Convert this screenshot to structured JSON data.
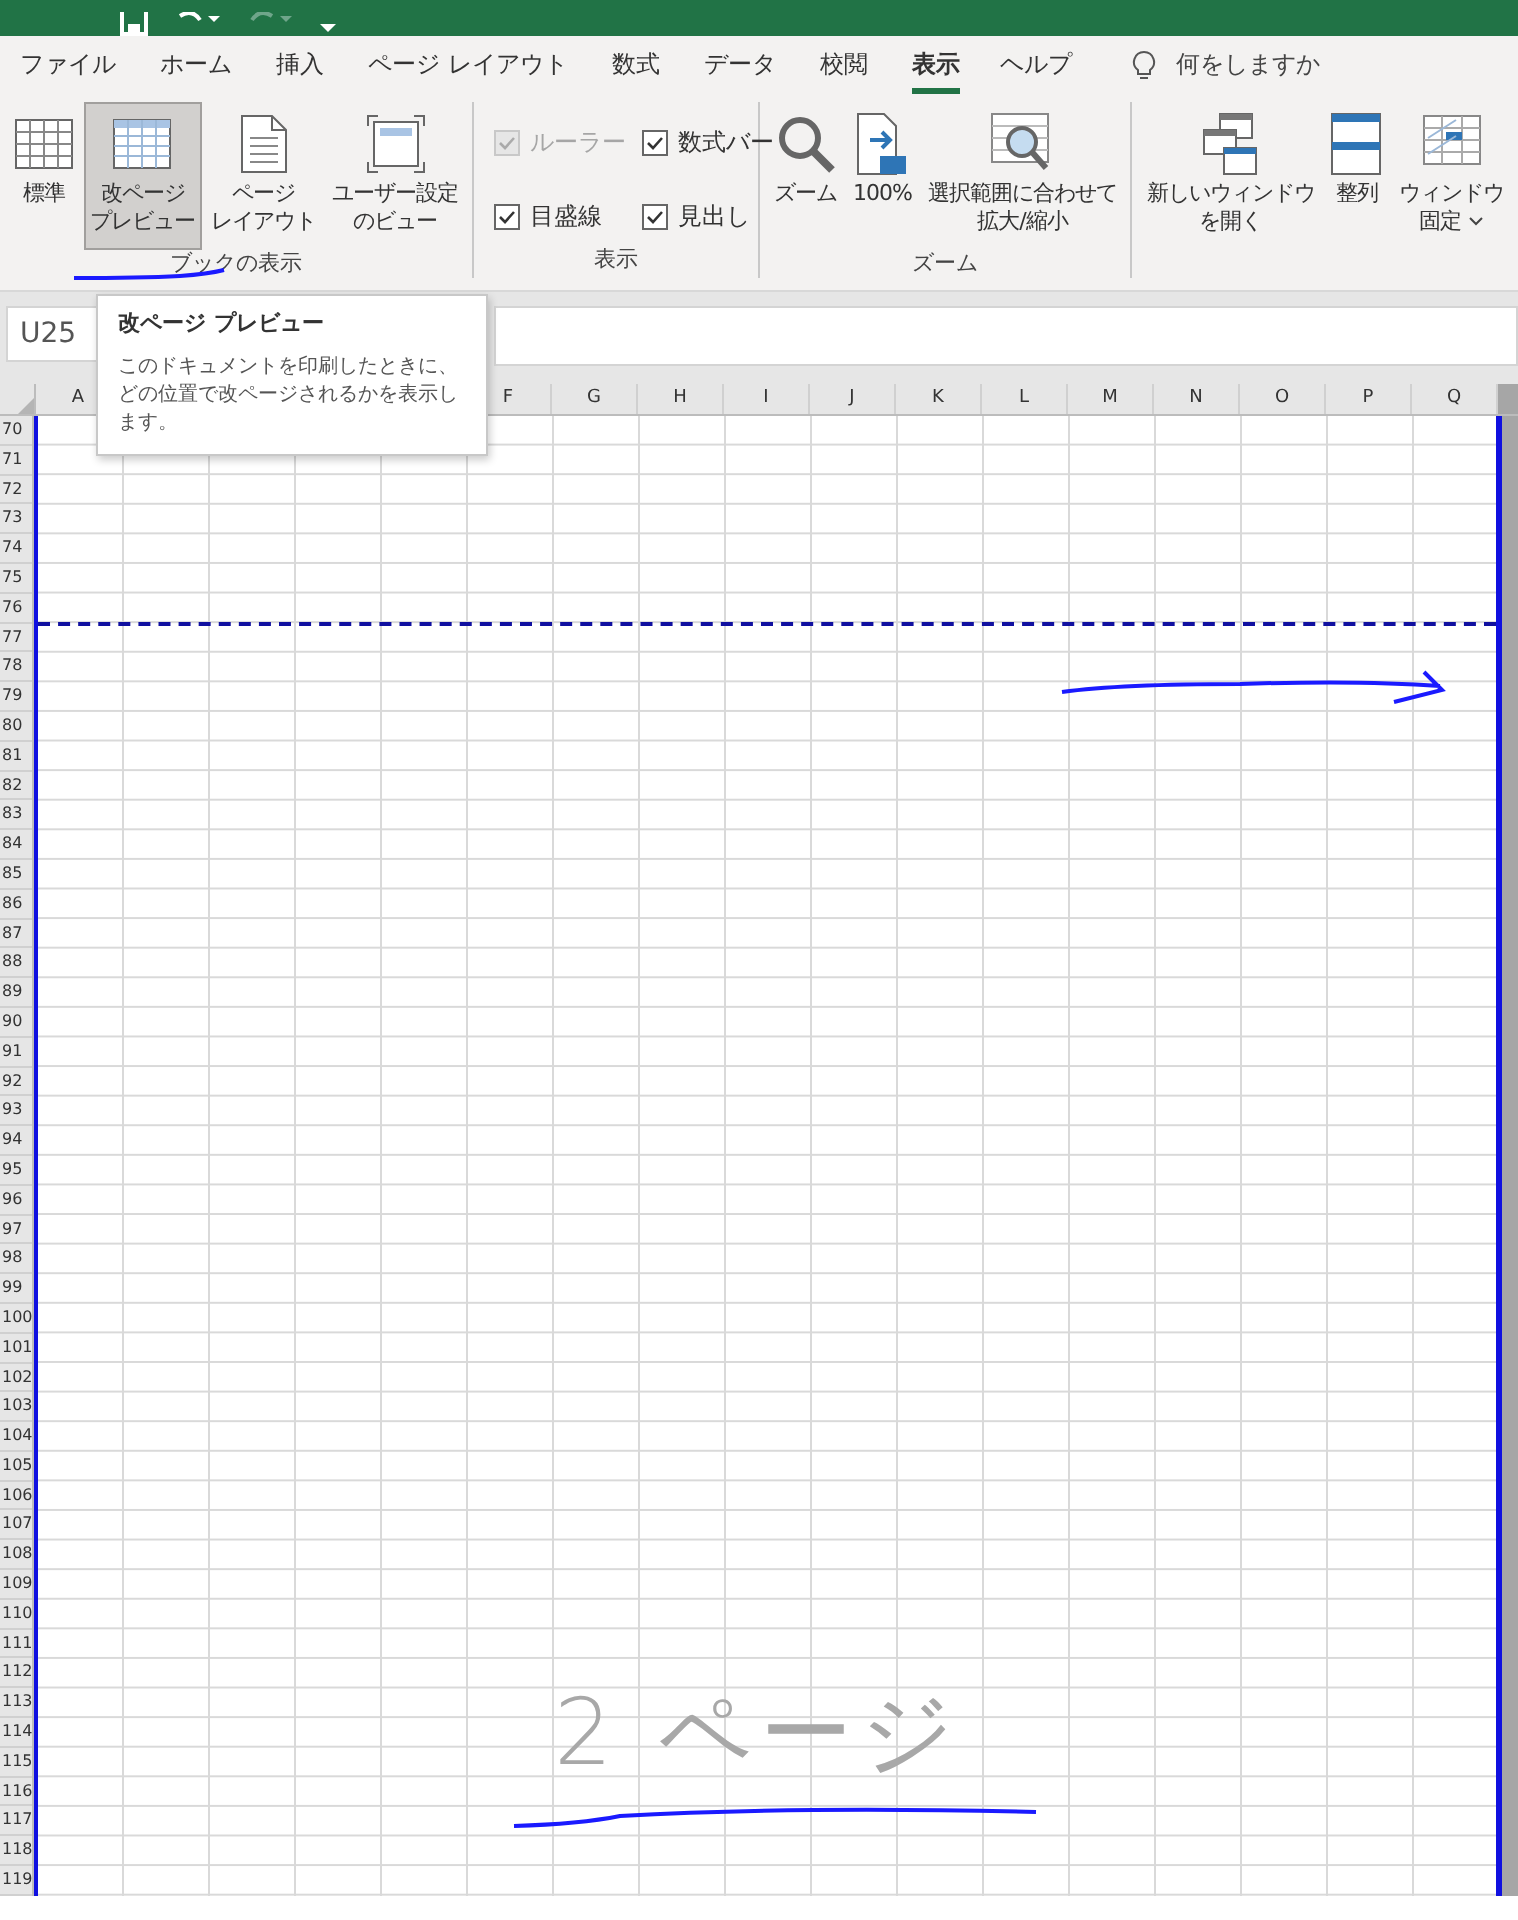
{
  "quick_access": [
    {
      "kind": "save"
    },
    {
      "kind": "undo"
    },
    {
      "kind": "redo",
      "disabled": true
    },
    {
      "kind": "customize"
    }
  ],
  "tabs": [
    {
      "label": "ファイル",
      "selected": false
    },
    {
      "label": "ホーム",
      "selected": false
    },
    {
      "label": "挿入",
      "selected": false
    },
    {
      "label": "ページ レイアウト",
      "selected": false
    },
    {
      "label": "数式",
      "selected": false
    },
    {
      "label": "データ",
      "selected": false
    },
    {
      "label": "校閲",
      "selected": false
    },
    {
      "label": "表示",
      "selected": true
    },
    {
      "label": "ヘルプ",
      "selected": false
    }
  ],
  "tell_me": {
    "placeholder": "何をしますか"
  },
  "ribbon_groups": [
    {
      "label": "ブックの表示",
      "kind": "buttons",
      "items": [
        {
          "lines": [
            "標準"
          ],
          "selected": false
        },
        {
          "lines": [
            "改ページ",
            "プレビュー"
          ],
          "selected": true
        },
        {
          "lines": [
            "ページ",
            "レイアウト"
          ],
          "selected": false
        },
        {
          "lines": [
            "ユーザー設定",
            "のビュー"
          ],
          "selected": false
        }
      ]
    },
    {
      "label": "表示",
      "kind": "checks",
      "items": [
        {
          "label": "ルーラー",
          "checked": true,
          "disabled": true
        },
        {
          "label": "数式バー",
          "checked": true,
          "disabled": false
        },
        {
          "label": "目盛線",
          "checked": true,
          "disabled": false
        },
        {
          "label": "見出し",
          "checked": true,
          "disabled": false
        }
      ]
    },
    {
      "label": "ズーム",
      "kind": "buttons",
      "items": [
        {
          "lines": [
            "ズーム"
          ],
          "selected": false
        },
        {
          "lines": [
            "100%"
          ],
          "selected": false
        },
        {
          "lines": [
            "選択範囲に合わせて",
            "拡大/縮小"
          ],
          "selected": false
        }
      ]
    },
    {
      "kind": "buttons",
      "items": [
        {
          "lines": [
            "新しいウィンドウ",
            "を開く"
          ],
          "selected": false
        },
        {
          "lines": [
            "整列"
          ],
          "selected": false
        },
        {
          "lines": [
            "ウィンドウ",
            "固定"
          ],
          "selected": false,
          "dropdown": true
        }
      ]
    }
  ],
  "name_box": {
    "value": "U25"
  },
  "tooltip": {
    "title": "改ページ プレビュー",
    "text": "このドキュメントを印刷したときに、どの位置で改ページされるかを表示します。"
  },
  "sheet": {
    "columns": [
      "A",
      "F",
      "G",
      "H",
      "I",
      "J",
      "K",
      "L",
      "M",
      "N",
      "O",
      "P",
      "Q"
    ],
    "rows": [
      {
        "label": "70"
      },
      {
        "label": "71"
      },
      {
        "label": "72"
      },
      {
        "label": "73"
      },
      {
        "label": "74"
      },
      {
        "label": "75"
      },
      {
        "label": "76",
        "page_break_below": true
      },
      {
        "label": "77"
      },
      {
        "label": "78"
      },
      {
        "label": "79"
      },
      {
        "label": "80"
      },
      {
        "label": "81"
      },
      {
        "label": "82"
      },
      {
        "label": "83"
      },
      {
        "label": "84"
      },
      {
        "label": "85"
      },
      {
        "label": "86"
      },
      {
        "label": "87"
      },
      {
        "label": "88"
      },
      {
        "label": "89"
      },
      {
        "label": "90"
      },
      {
        "label": "91"
      },
      {
        "label": "92"
      },
      {
        "label": "93"
      },
      {
        "label": "94"
      },
      {
        "label": "95"
      },
      {
        "label": "96"
      },
      {
        "label": "97"
      },
      {
        "label": "98"
      },
      {
        "label": "99"
      },
      {
        "label": "100"
      },
      {
        "label": "101"
      },
      {
        "label": "102"
      },
      {
        "label": "103"
      },
      {
        "label": "104"
      },
      {
        "label": "105"
      },
      {
        "label": "106"
      },
      {
        "label": "107"
      },
      {
        "label": "108"
      },
      {
        "label": "109"
      },
      {
        "label": "110"
      },
      {
        "label": "111"
      },
      {
        "label": "112"
      },
      {
        "label": "113"
      },
      {
        "label": "114"
      },
      {
        "label": "115"
      },
      {
        "label": "116"
      },
      {
        "label": "117"
      },
      {
        "label": "118"
      },
      {
        "label": "119"
      }
    ],
    "page_label": "2 ページ"
  }
}
